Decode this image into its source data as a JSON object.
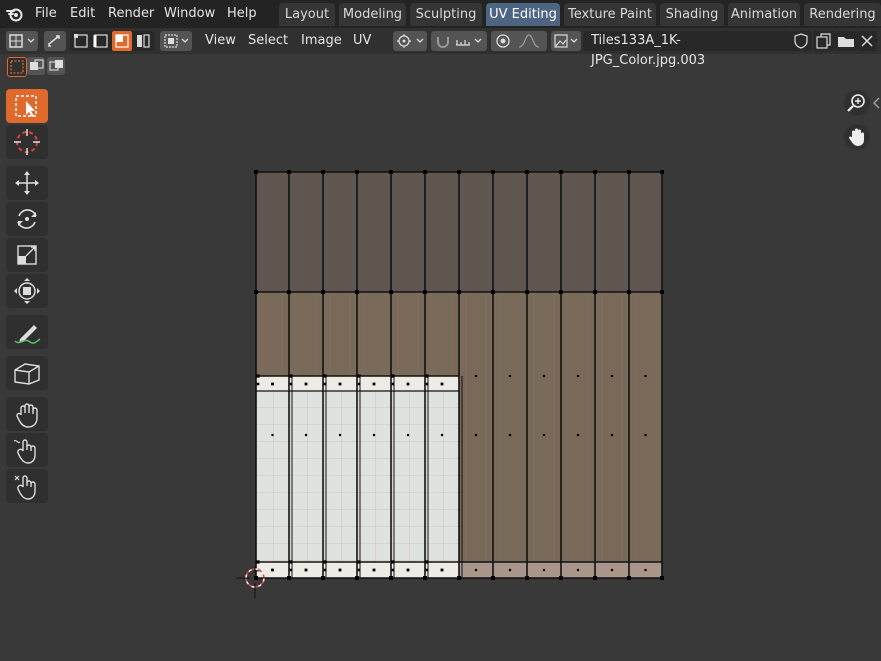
{
  "top_menu": {
    "items": [
      {
        "label": "File"
      },
      {
        "label": "Edit"
      },
      {
        "label": "Render"
      },
      {
        "label": "Window"
      },
      {
        "label": "Help"
      }
    ]
  },
  "workspace_tabs": [
    {
      "label": "Layout",
      "active": false
    },
    {
      "label": "Modeling",
      "active": false
    },
    {
      "label": "Sculpting",
      "active": false
    },
    {
      "label": "UV Editing",
      "active": true
    },
    {
      "label": "Texture Paint",
      "active": false
    },
    {
      "label": "Shading",
      "active": false
    },
    {
      "label": "Animation",
      "active": false
    },
    {
      "label": "Rendering",
      "active": false
    }
  ],
  "header": {
    "menus": [
      {
        "label": "View"
      },
      {
        "label": "Select"
      },
      {
        "label": "Image"
      },
      {
        "label": "UV"
      }
    ],
    "image_name": "Tiles133A_1K-JPG_Color.jpg.003"
  },
  "colors": {
    "accent": "#e06a2c",
    "active_tab": "#4d6582",
    "topbar": "#232323",
    "header": "#303030",
    "viewport": "#393939",
    "wood_dark": "#5f5650",
    "wood_light": "#7a6a5a",
    "tile": "#dfe3df"
  },
  "toolbar": {
    "tools": [
      {
        "name": "select-box-icon",
        "active": true
      },
      {
        "name": "cursor-icon",
        "active": false
      },
      {
        "name": "move-icon",
        "active": false
      },
      {
        "name": "rotate-icon",
        "active": false
      },
      {
        "name": "scale-icon",
        "active": false
      },
      {
        "name": "transform-icon",
        "active": false
      },
      {
        "name": "annotate-icon",
        "active": false
      },
      {
        "name": "sample-icon",
        "active": false
      },
      {
        "name": "grab-icon",
        "active": false
      },
      {
        "name": "relax-icon",
        "active": false
      },
      {
        "name": "pinch-icon",
        "active": false
      }
    ]
  }
}
